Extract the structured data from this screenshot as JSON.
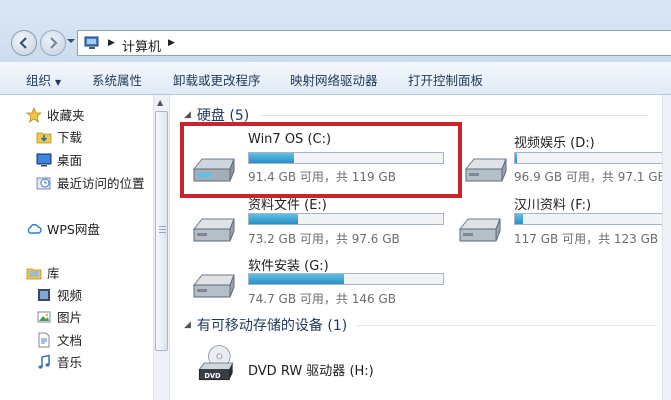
{
  "address": {
    "crumb": "计算机"
  },
  "toolbar": {
    "organize": "组织",
    "properties": "系统属性",
    "uninstall": "卸载或更改程序",
    "map_drive": "映射网络驱动器",
    "control_panel": "打开控制面板"
  },
  "sidebar": {
    "favorites": "收藏夹",
    "downloads": "下载",
    "desktop": "桌面",
    "recent": "最近访问的位置",
    "wps": "WPS网盘",
    "library": "库",
    "videos": "视频",
    "pictures": "图片",
    "documents": "文档",
    "music": "音乐"
  },
  "sections": {
    "hard_disks": "硬盘 (5)",
    "removable": "有可移动存储的设备 (1)"
  },
  "drives": [
    {
      "name": "Win7 OS (C:)",
      "size": "91.4 GB 可用，共 119 GB",
      "used_fraction": 0.23
    },
    {
      "name": "视频娱乐 (D:)",
      "size": "96.9 GB 可用，共 97.1 GB",
      "used_fraction": 0.01
    },
    {
      "name": "资料文件 (E:)",
      "size": "73.2 GB 可用，共 97.6 GB",
      "used_fraction": 0.25
    },
    {
      "name": "汉川资料 (F:)",
      "size": "117 GB 可用，共 123 GB",
      "used_fraction": 0.05
    },
    {
      "name": "软件安装 (G:)",
      "size": "74.7 GB 可用，共 146 GB",
      "used_fraction": 0.49
    }
  ],
  "dvd": {
    "name": "DVD RW 驱动器 (H:)",
    "icon_text": "DVD"
  },
  "colors": {
    "highlight": "#c4252f",
    "bar_fill": "#2a8fc6"
  }
}
